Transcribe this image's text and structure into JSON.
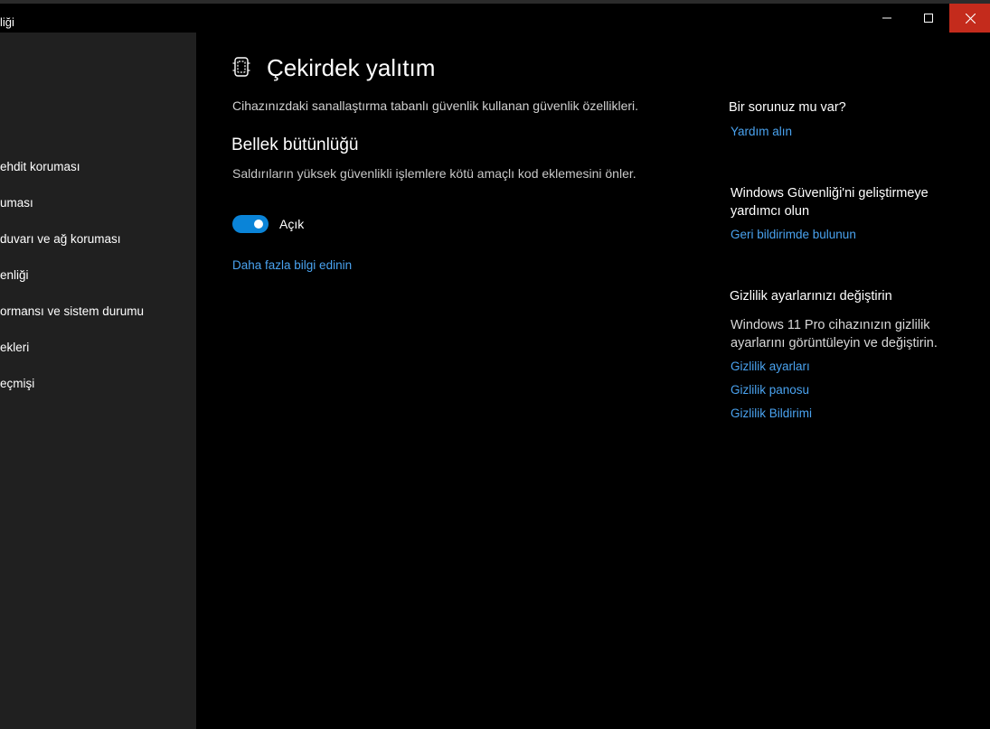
{
  "window": {
    "title": "liği",
    "minimize_icon": "minimize-icon",
    "maximize_icon": "maximize-icon",
    "close_icon": "close-icon",
    "close_color": "#c42b1c"
  },
  "sidebar": {
    "items": [
      {
        "label": "ehdit koruması"
      },
      {
        "label": "uması"
      },
      {
        "label": "duvarı ve ağ koruması"
      },
      {
        "label": "enliği"
      },
      {
        "label": "ormansı ve sistem durumu"
      },
      {
        "label": "ekleri"
      },
      {
        "label": "eçmişi"
      }
    ]
  },
  "main": {
    "icon": "core-isolation-icon",
    "title": "Çekirdek yalıtım",
    "description": "Cihazınızdaki sanallaştırma tabanlı güvenlik kullanan güvenlik özellikleri.",
    "section": {
      "title": "Bellek bütünlüğü",
      "description": "Saldırıların yüksek güvenlikli işlemlere kötü amaçlı kod eklemesini önler.",
      "toggle_state": "on",
      "toggle_label": "Açık",
      "toggle_color": "#0a84d8"
    },
    "learn_more": "Daha fazla bilgi edinin"
  },
  "right_panel": {
    "question": {
      "title": "Bir sorunuz mu var?",
      "link": "Yardım alın"
    },
    "feedback": {
      "title_line1": "Windows Güvenliği'ni geliştirmeye",
      "title_line2": "yardımcı olun",
      "link": "Geri bildirimde bulunun"
    },
    "privacy": {
      "title": "Gizlilik ayarlarınızı değiştirin",
      "text_line1": "Windows 11 Pro cihazınızın gizlilik",
      "text_line2": "ayarlarını görüntüleyin ve değiştirin.",
      "links": [
        "Gizlilik ayarları",
        "Gizlilik panosu",
        "Gizlilik Bildirimi"
      ]
    }
  },
  "colors": {
    "link": "#4aa3f0",
    "sidebar_bg": "#202020",
    "main_bg": "#000000"
  }
}
